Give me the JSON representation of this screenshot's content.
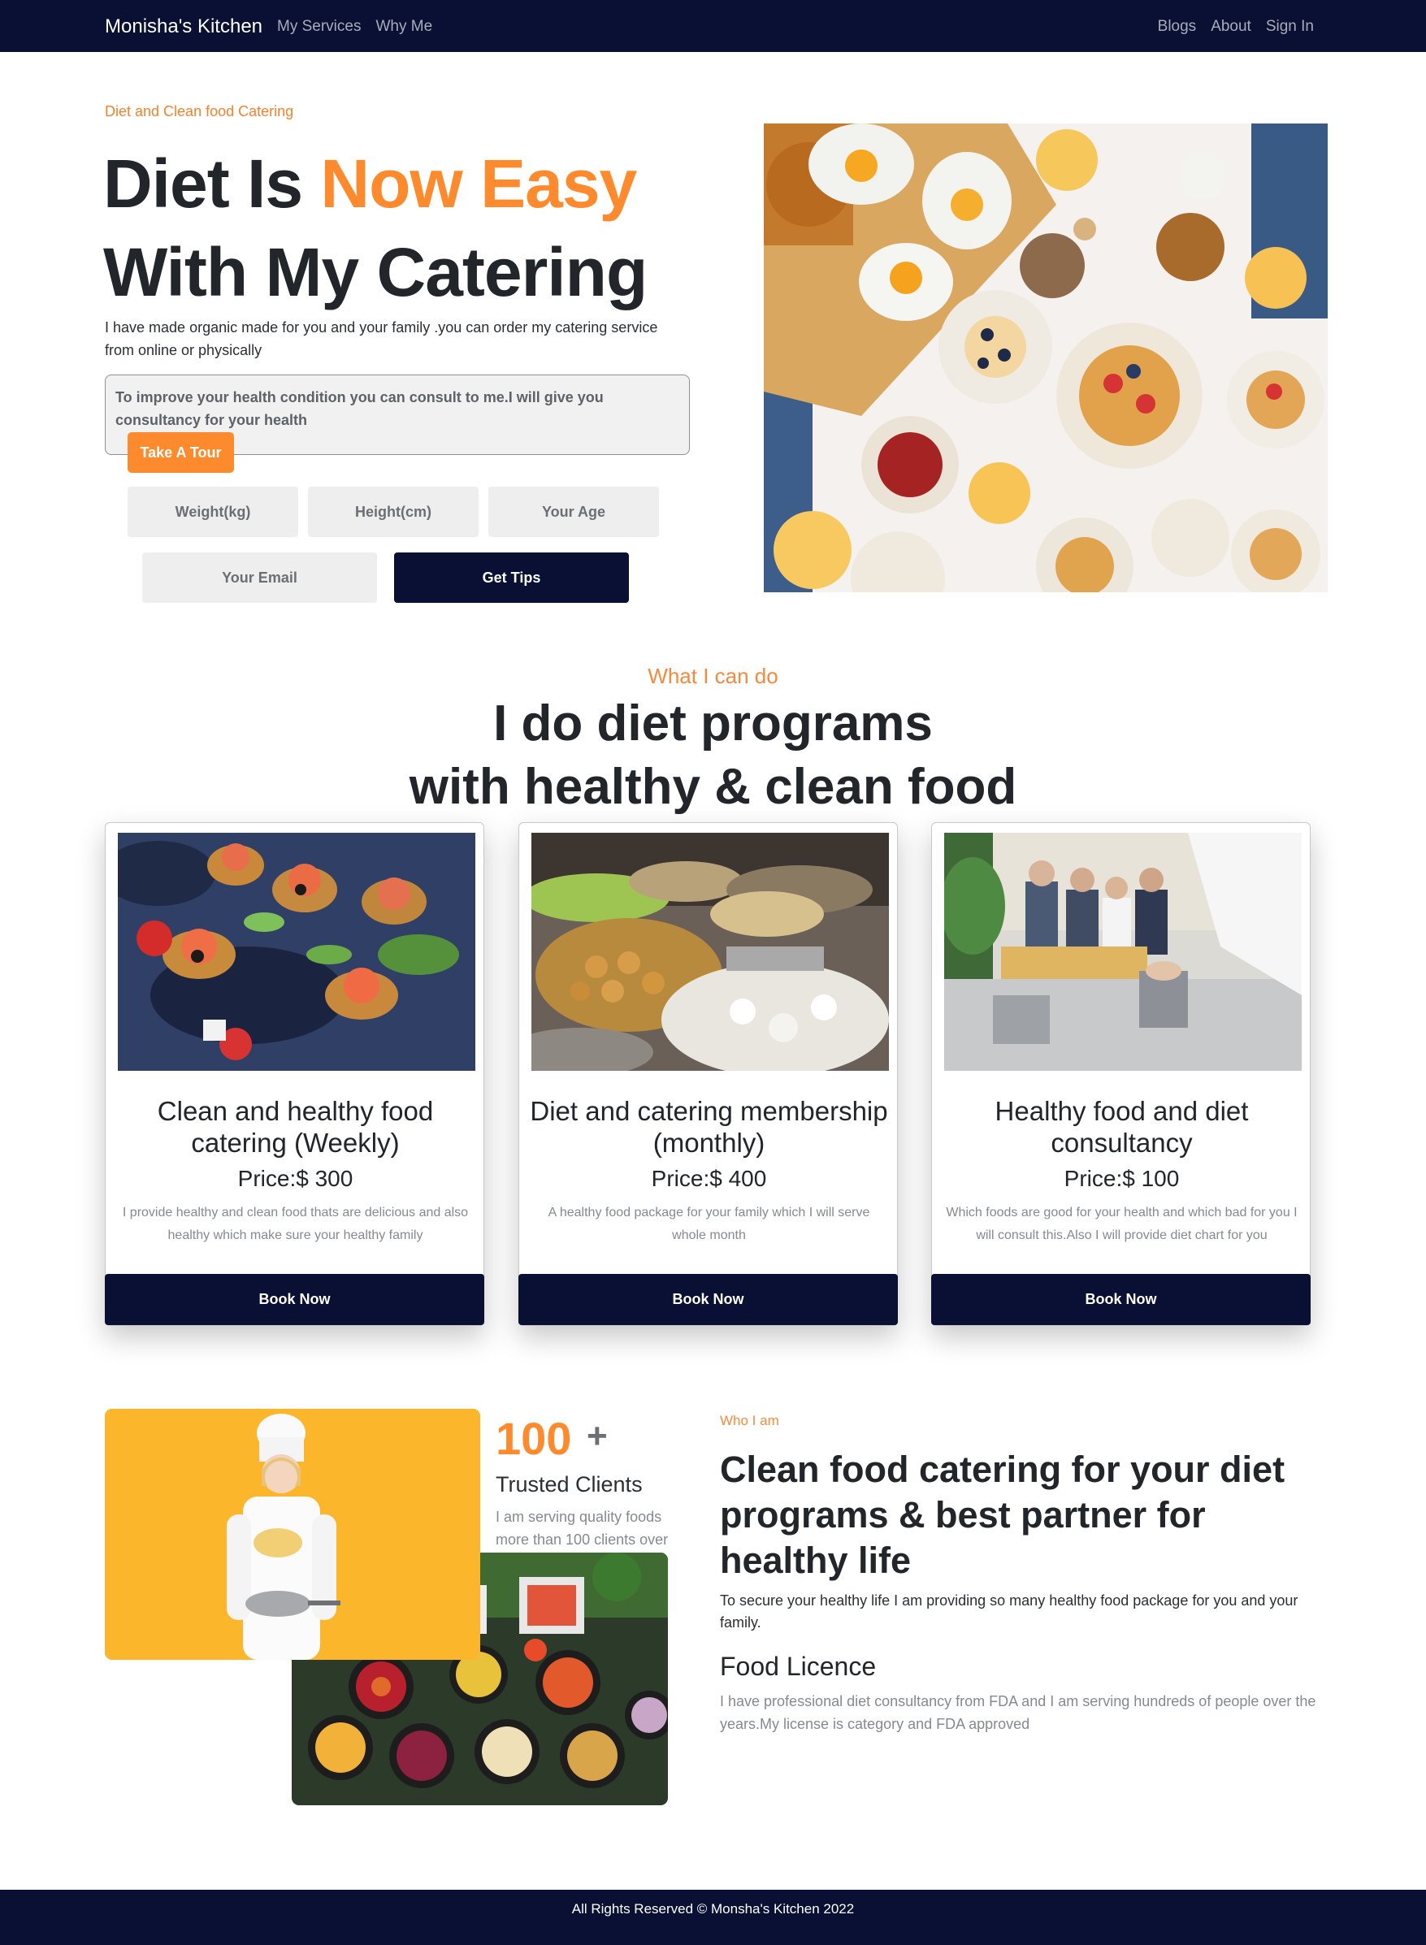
{
  "nav": {
    "brand": "Monisha's Kitchen",
    "left_links": [
      "My Services",
      "Why Me"
    ],
    "right_links": [
      "Blogs",
      "About",
      "Sign In"
    ]
  },
  "hero": {
    "eyebrow": "Diet and Clean food Catering",
    "title_part1": "Diet Is ",
    "title_accent": "Now Easy",
    "title_line2": "With My Catering",
    "description": "I have made organic made for you and your family .you can order my catering service from online or physically",
    "consult_text": "To improve your health condition you can consult to me.I will give you consultancy for your health",
    "tour_button": "Take A Tour",
    "fields": {
      "weight": "Weight(kg)",
      "height": "Height(cm)",
      "age": "Your Age",
      "email": "Your Email"
    },
    "tips_button": "Get Tips"
  },
  "services": {
    "eyebrow": "What I can do",
    "title_line1": "I do diet programs",
    "title_line2": "with healthy & clean food",
    "cards": [
      {
        "title": "Clean and healthy food catering (Weekly)",
        "price": "Price:$ 300",
        "description": "I provide healthy and clean food thats are delicious and also healthy which make sure your healthy family",
        "button": "Book Now"
      },
      {
        "title": "Diet and catering membership (monthly)",
        "price": "Price:$ 400",
        "description": "A healthy food package for your family which I will serve whole month",
        "button": "Book Now"
      },
      {
        "title": "Healthy food and diet consultancy",
        "price": "Price:$ 100",
        "description": "Which foods are good for your health and which bad for you I will consult this.Also I will provide diet chart for you",
        "button": "Book Now"
      }
    ]
  },
  "about": {
    "stat_number": "100",
    "stat_plus": "+",
    "stat_label": "Trusted Clients",
    "stat_description": "I am serving quality foods more than 100 clients over",
    "eyebrow": "Who I am",
    "title": "Clean food catering for your diet programs & best partner for healthy life",
    "description": "To secure your healthy life I am providing so many healthy food package for you and your family.",
    "licence_title": "Food Licence",
    "licence_description": "I have professional diet consultancy from FDA and I am serving hundreds of people over the years.My license is category and FDA approved"
  },
  "footer": {
    "text": "All Rights Reserved © Monsha's Kitchen 2022"
  }
}
